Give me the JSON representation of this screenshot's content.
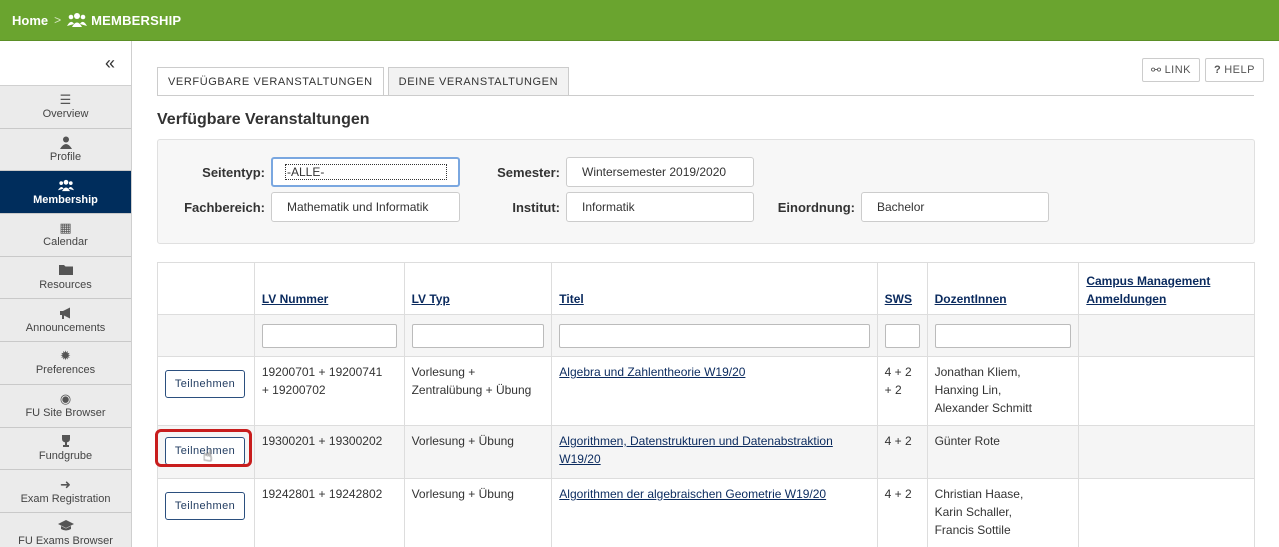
{
  "breadcrumb": {
    "home": "Home",
    "separator": ">",
    "current": "MEMBERSHIP",
    "icon": "people-icon"
  },
  "sidebar": {
    "collapse_glyph": "«",
    "items": [
      {
        "label": "Overview",
        "icon": "list-icon",
        "glyph": "☰",
        "active": false
      },
      {
        "label": "Profile",
        "icon": "user-icon",
        "glyph": "👤",
        "active": false
      },
      {
        "label": "Membership",
        "icon": "people-icon",
        "glyph": "👥",
        "active": true
      },
      {
        "label": "Calendar",
        "icon": "calendar-icon",
        "glyph": "▦",
        "active": false
      },
      {
        "label": "Resources",
        "icon": "folder-icon",
        "glyph": "▬",
        "active": false
      },
      {
        "label": "Announcements",
        "icon": "megaphone-icon",
        "glyph": "◁",
        "active": false
      },
      {
        "label": "Preferences",
        "icon": "gear-icon",
        "glyph": "✹",
        "active": false
      },
      {
        "label": "FU Site Browser",
        "icon": "compass-icon",
        "glyph": "◉",
        "active": false
      },
      {
        "label": "Fundgrube",
        "icon": "trophy-icon",
        "glyph": "♕",
        "active": false
      },
      {
        "label": "Exam Registration",
        "icon": "sign-in-icon",
        "glyph": "➜",
        "active": false
      },
      {
        "label": "FU Exams Browser",
        "icon": "graduation-cap-icon",
        "glyph": "🎓",
        "active": false
      }
    ]
  },
  "tabs": [
    {
      "label": "VERFÜGBARE VERANSTALTUNGEN",
      "active": true
    },
    {
      "label": "DEINE VERANSTALTUNGEN",
      "active": false
    }
  ],
  "toolbar": {
    "link_label": "LINK",
    "help_label": "HELP",
    "link_glyph": "⚯",
    "help_glyph": "?"
  },
  "page_title": "Verfügbare Veranstaltungen",
  "filters": {
    "seitentyp_label": "Seitentyp:",
    "seitentyp_value": "-ALLE-",
    "semester_label": "Semester:",
    "semester_value": "Wintersemester 2019/2020",
    "fachbereich_label": "Fachbereich:",
    "fachbereich_value": "Mathematik und Informatik",
    "institut_label": "Institut:",
    "institut_value": "Informatik",
    "einordnung_label": "Einordnung:",
    "einordnung_value": "Bachelor"
  },
  "table": {
    "headers": {
      "lv_nummer": "LV Nummer",
      "lv_typ": "LV Typ",
      "titel": "Titel",
      "sws": "SWS",
      "dozentinnen": "DozentInnen",
      "campus_1": "Campus Management",
      "campus_2": "Anmeldungen"
    },
    "button_label": "Teilnehmen",
    "rows": [
      {
        "nummer_1": "19200701 + 19200741",
        "nummer_2": "+ 19200702",
        "typ_1": "Vorlesung +",
        "typ_2": "Zentralübung + Übung",
        "titel_1": "Algebra und Zahlentheorie W19/20",
        "titel_2": "",
        "sws_1": "4 + 2",
        "sws_2": "+ 2",
        "doz_1": "Jonathan Kliem,",
        "doz_2": "Hanxing Lin,",
        "doz_3": "Alexander Schmitt"
      },
      {
        "nummer_1": "19300201 + 19300202",
        "nummer_2": "",
        "typ_1": "Vorlesung + Übung",
        "typ_2": "",
        "titel_1": "Algorithmen, Datenstrukturen und Datenabstraktion",
        "titel_2": "W19/20",
        "sws_1": "4 + 2",
        "sws_2": "",
        "doz_1": "Günter Rote",
        "doz_2": "",
        "doz_3": ""
      },
      {
        "nummer_1": "19242801 + 19242802",
        "nummer_2": "",
        "typ_1": "Vorlesung + Übung",
        "typ_2": "",
        "titel_1": "Algorithmen der algebraischen Geometrie W19/20",
        "titel_2": "",
        "sws_1": "4 + 2",
        "sws_2": "",
        "doz_1": "Christian Haase,",
        "doz_2": "Karin Schaller,",
        "doz_3": "Francis Sottile"
      }
    ]
  },
  "colors": {
    "topbar": "#6aa42f",
    "active_nav": "#002d5c",
    "link": "#0a2a5e",
    "highlight": "#c81d1d"
  }
}
